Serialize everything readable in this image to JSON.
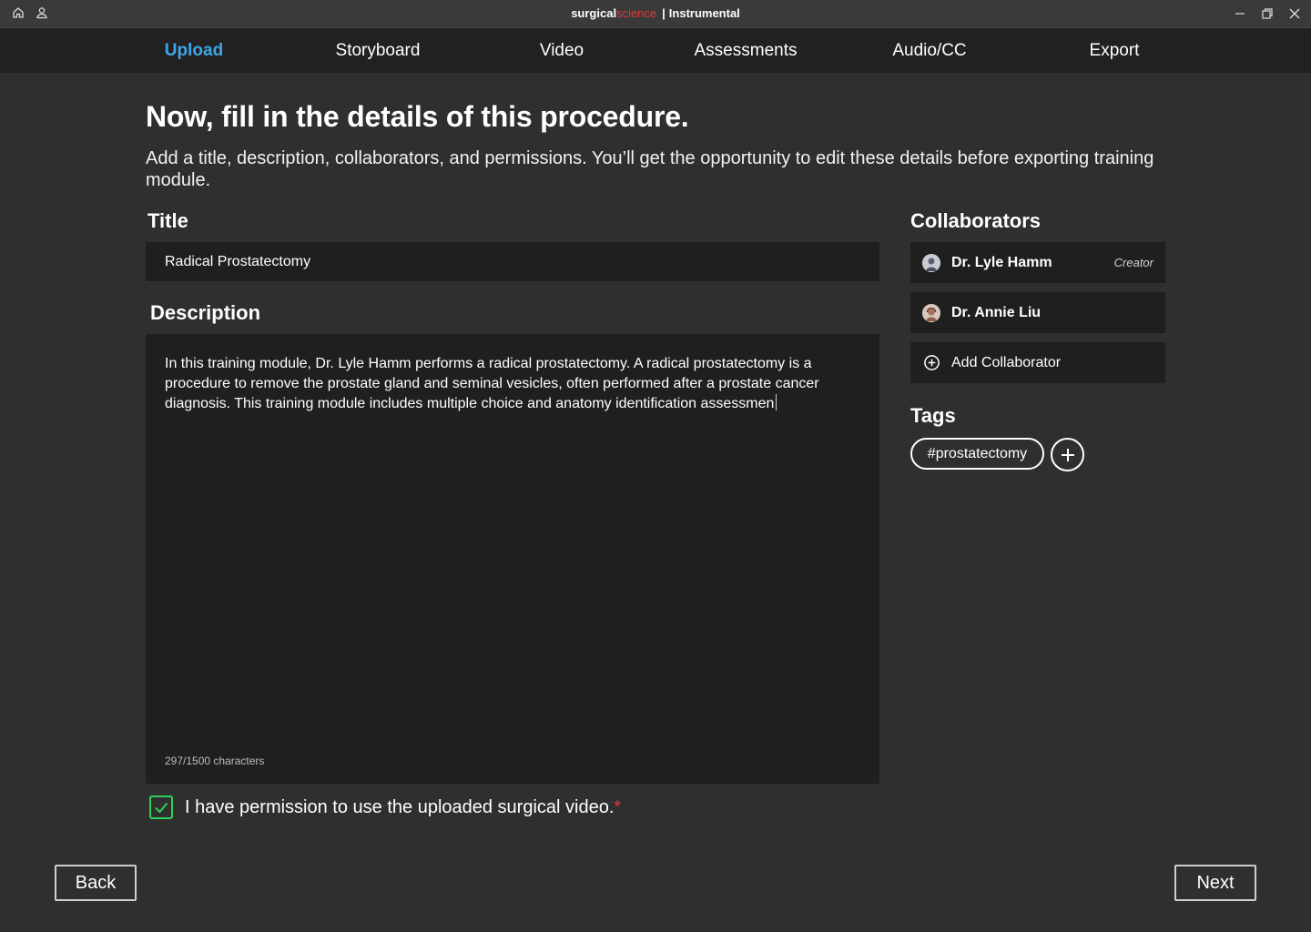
{
  "window": {
    "brand_part1": "surgical",
    "brand_part2": "science",
    "separator": "|",
    "app_name": "Instrumental",
    "left_icons": [
      "home-icon",
      "user-icon"
    ],
    "controls": [
      "minimize-icon",
      "restore-icon",
      "close-icon"
    ],
    "brand_accent": "#e0393b"
  },
  "nav": {
    "tabs": [
      {
        "label": "Upload",
        "active": true
      },
      {
        "label": "Storyboard",
        "active": false
      },
      {
        "label": "Video",
        "active": false
      },
      {
        "label": "Assessments",
        "active": false
      },
      {
        "label": "Audio/CC",
        "active": false
      },
      {
        "label": "Export",
        "active": false
      }
    ],
    "active_color": "#3ea6e6"
  },
  "page": {
    "heading": "Now, fill in the details of this procedure.",
    "subheading": "Add a title, description, collaborators, and permissions. You’ll get the opportunity to edit these details before exporting training module."
  },
  "form": {
    "title_label": "Title",
    "title_value": "Radical Prostatectomy",
    "description_label": "Description",
    "description_value": "In this training module, Dr. Lyle Hamm performs a radical prostatectomy. A radical prostatectomy is a procedure to remove the prostate gland and seminal vesicles, often performed after a prostate cancer diagnosis. This training module includes multiple choice and anatomy identification assessmen",
    "char_count": "297/1500 characters",
    "permission_label": "I have permission to use the uploaded surgical video.",
    "permission_required": "*",
    "permission_checked": true,
    "checkbox_color": "#2fd05a"
  },
  "collaborators": {
    "label": "Collaborators",
    "items": [
      {
        "name": "Dr. Lyle Hamm",
        "role": "Creator"
      },
      {
        "name": "Dr. Annie Liu",
        "role": ""
      }
    ],
    "add_label": "Add Collaborator"
  },
  "tags": {
    "label": "Tags",
    "items": [
      "#prostatectomy"
    ]
  },
  "footer": {
    "back_label": "Back",
    "next_label": "Next"
  }
}
